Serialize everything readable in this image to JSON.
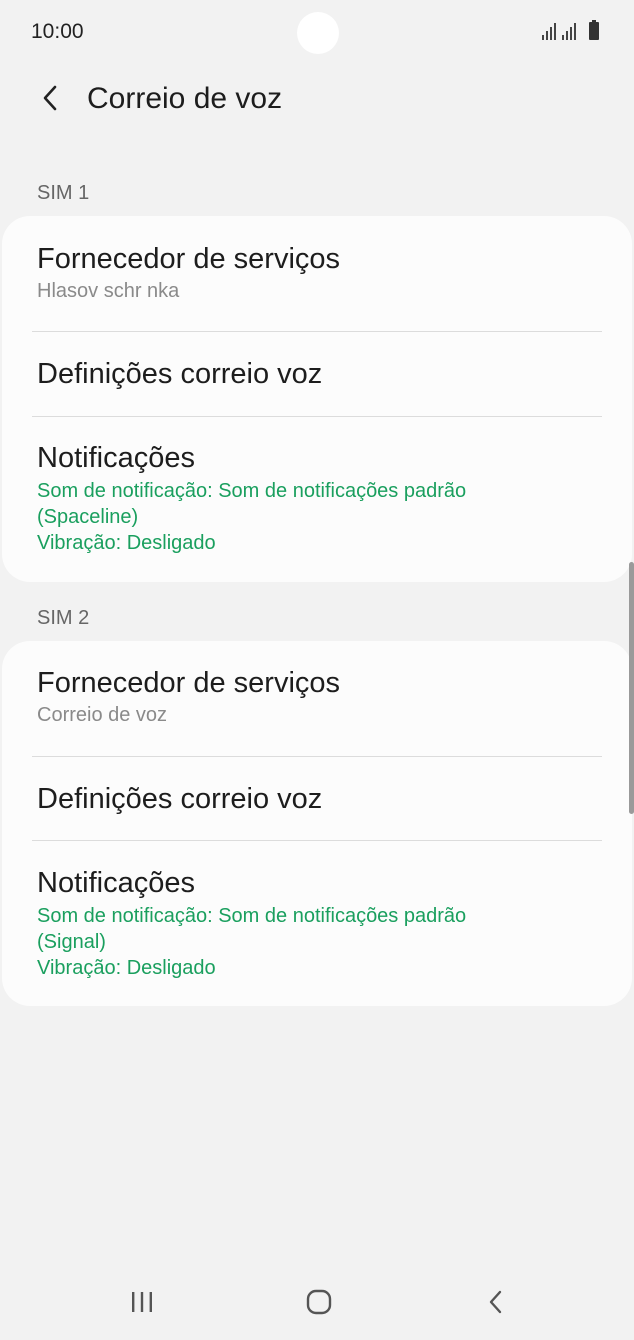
{
  "status_bar": {
    "time": "10:00"
  },
  "header": {
    "title": "Correio de voz",
    "back_icon": "chevron-left-icon"
  },
  "sim1": {
    "label": "SIM 1",
    "provider": {
      "title": "Fornecedor de serviços",
      "value": "Hlasov  schr nka"
    },
    "settings": {
      "title": "Definições correio voz"
    },
    "notifications": {
      "title": "Notificações",
      "sound_line1": "Som de notificação: Som de notificações padrão",
      "sound_line2": "(Spaceline)",
      "vibration": "Vibração: Desligado"
    }
  },
  "sim2": {
    "label": "SIM 2",
    "provider": {
      "title": "Fornecedor de serviços",
      "value": "Correio de voz"
    },
    "settings": {
      "title": "Definições correio voz"
    },
    "notifications": {
      "title": "Notificações",
      "sound_line1": "Som de notificação: Som de notificações padrão",
      "sound_line2": "(Signal)",
      "vibration": "Vibração: Desligado"
    }
  },
  "nav_bar": {
    "recents_icon": "recents-icon",
    "home_icon": "home-icon",
    "back_icon": "back-icon"
  },
  "colors": {
    "background": "#f2f2f2",
    "card": "#fcfcfc",
    "accent_green": "#1a9f5e",
    "text_primary": "#1d1d1d",
    "text_secondary": "#8a8a8a"
  }
}
